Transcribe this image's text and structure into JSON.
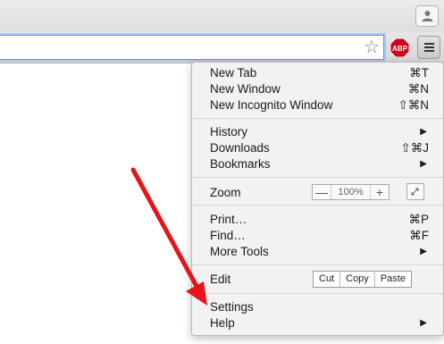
{
  "titlebar": {
    "profile_icon": "person-icon"
  },
  "toolbar": {
    "bookmark_icon": "star-icon",
    "adblock": {
      "label": "ABP",
      "color": "#d0021b"
    },
    "menu_icon": "hamburger-icon"
  },
  "menu": {
    "new_tab": {
      "label": "New Tab",
      "shortcut": "⌘T"
    },
    "new_window": {
      "label": "New Window",
      "shortcut": "⌘N"
    },
    "new_incognito": {
      "label": "New Incognito Window",
      "shortcut": "⇧⌘N"
    },
    "history": {
      "label": "History"
    },
    "downloads": {
      "label": "Downloads",
      "shortcut": "⇧⌘J"
    },
    "bookmarks": {
      "label": "Bookmarks"
    },
    "zoom": {
      "label": "Zoom",
      "minus": "—",
      "value": "100%",
      "plus": "+"
    },
    "print": {
      "label": "Print…",
      "shortcut": "⌘P"
    },
    "find": {
      "label": "Find…",
      "shortcut": "⌘F"
    },
    "more_tools": {
      "label": "More Tools"
    },
    "edit": {
      "label": "Edit",
      "cut": "Cut",
      "copy": "Copy",
      "paste": "Paste"
    },
    "settings": {
      "label": "Settings"
    },
    "help": {
      "label": "Help"
    },
    "submenu_arrow": "▶"
  },
  "annotation": {
    "arrow_color": "#e8141a"
  }
}
